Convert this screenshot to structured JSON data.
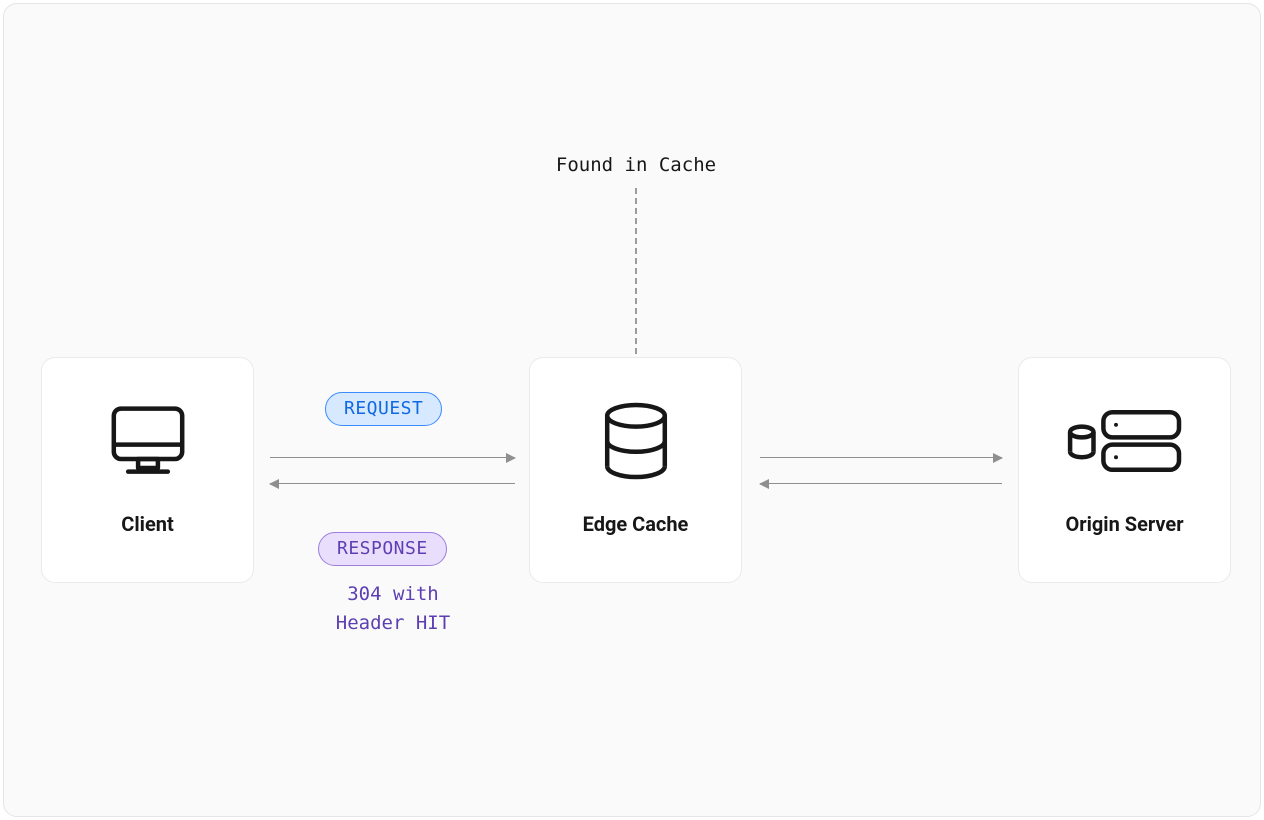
{
  "callout": "Found in Cache",
  "nodes": {
    "client": {
      "label": "Client"
    },
    "edge": {
      "label": "Edge Cache"
    },
    "origin": {
      "label": "Origin Server"
    }
  },
  "pills": {
    "request": "REQUEST",
    "response": "RESPONSE"
  },
  "response_detail": "304 with\nHeader HIT"
}
